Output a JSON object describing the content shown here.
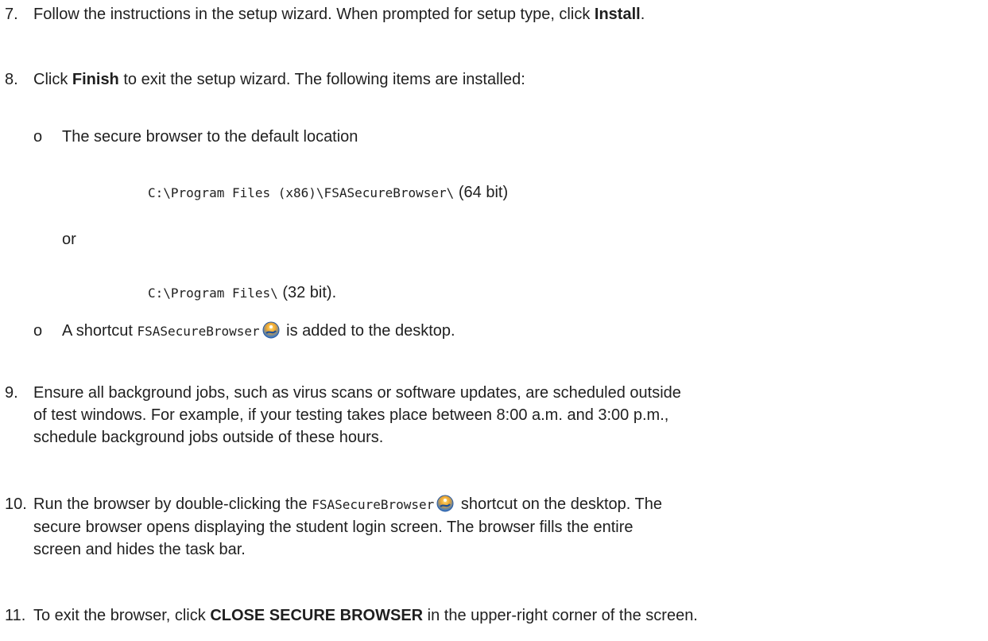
{
  "steps": {
    "s7": {
      "number": "7.",
      "text_a": "Follow the instructions in the setup wizard. When prompted for setup type, click ",
      "bold": "Install",
      "text_b": "."
    },
    "s8": {
      "number": "8.",
      "text_a": "Click ",
      "bold": "Finish",
      "text_b": " to exit the setup wizard. The following items are installed:",
      "bullet_mark": "o",
      "bullet1": "The secure browser to the default location",
      "path64": "C:\\Program Files (x86)\\FSASecureBrowser\\",
      "path64_suffix": "(64 bit)",
      "or": "or",
      "path32": "C:\\Program Files\\",
      "path32_suffix": "(32 bit).",
      "bullet2_a": "A shortcut ",
      "bullet2_code": "FSASecureBrowser",
      "bullet2_b": " is added to the desktop."
    },
    "s9": {
      "number": "9.",
      "line1": "Ensure all background jobs, such as virus scans or software updates, are scheduled outside",
      "line2": "of test windows. For example, if your testing takes place between 8:00 a.m. and 3:00 p.m.,",
      "line3": "schedule background jobs outside of these hours."
    },
    "s10": {
      "number": "10.",
      "line1_a": "Run the browser by double-clicking the ",
      "line1_code": "FSASecureBrowser",
      "line1_b": " shortcut on the desktop. The",
      "line2": "secure browser opens displaying the student login screen. The browser fills the entire",
      "line3": "screen and hides the task bar."
    },
    "s11": {
      "number": "11.",
      "text_a": "To exit the browser, click ",
      "bold": "CLOSE SECURE BROWSER",
      "text_b": " in the upper-right corner of the screen."
    }
  },
  "icons": {
    "app": "fsa-secure-browser-icon"
  }
}
